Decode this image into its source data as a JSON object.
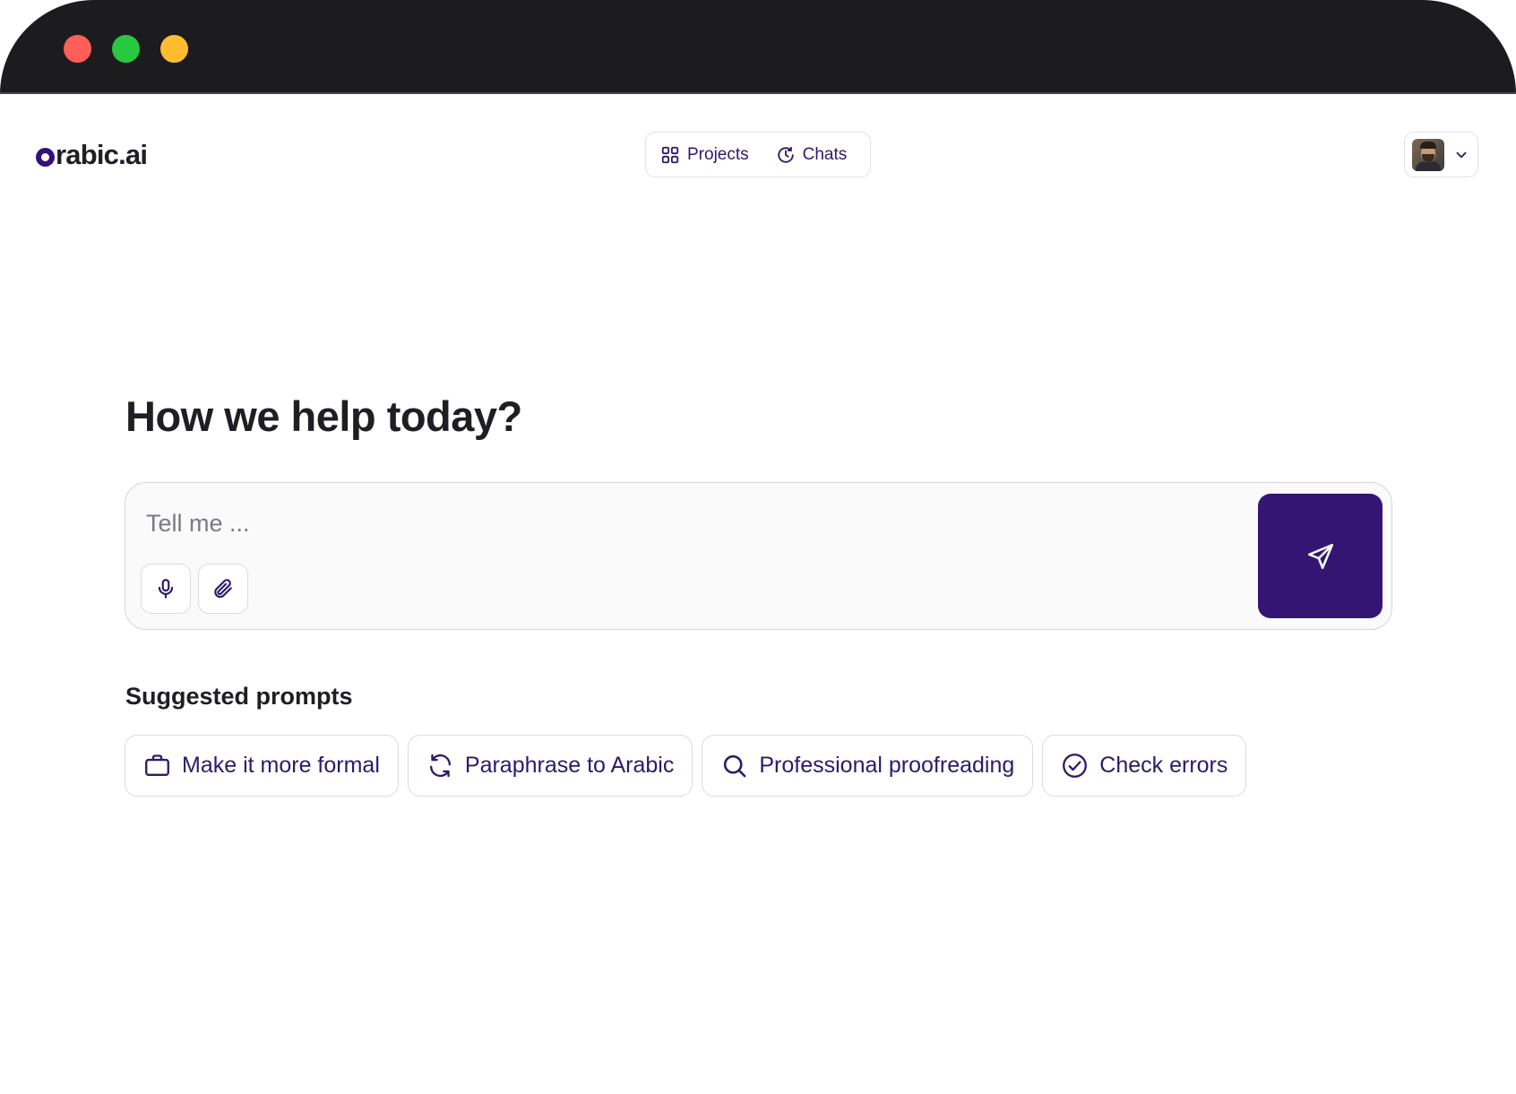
{
  "app": {
    "logo_text": "rabic.ai"
  },
  "nav": {
    "items": [
      {
        "label": "Projects",
        "icon": "grid-icon"
      },
      {
        "label": "Chats",
        "icon": "history-clock-icon"
      }
    ]
  },
  "profile": {
    "avatar": "user-avatar",
    "menu_icon": "chevron-down-icon"
  },
  "main": {
    "heading": "How we help today?",
    "composer": {
      "placeholder": "Tell me ...",
      "value": "",
      "mic_icon": "microphone-icon",
      "attach_icon": "paperclip-icon",
      "send_icon": "send-icon"
    },
    "suggestions": {
      "title": "Suggested prompts",
      "items": [
        {
          "label": "Make it more formal",
          "icon": "briefcase-icon"
        },
        {
          "label": "Paraphrase to Arabic",
          "icon": "refresh-icon"
        },
        {
          "label": "Professional proofreading",
          "icon": "search-icon"
        },
        {
          "label": "Check errors",
          "icon": "check-circle-icon"
        }
      ]
    }
  },
  "colors": {
    "accent": "#341574",
    "accent_text": "#2d1a6b",
    "titlebar": "#1c1c1e",
    "close": "#ff5f57",
    "zoom": "#28c840",
    "minimize": "#febc2e"
  }
}
